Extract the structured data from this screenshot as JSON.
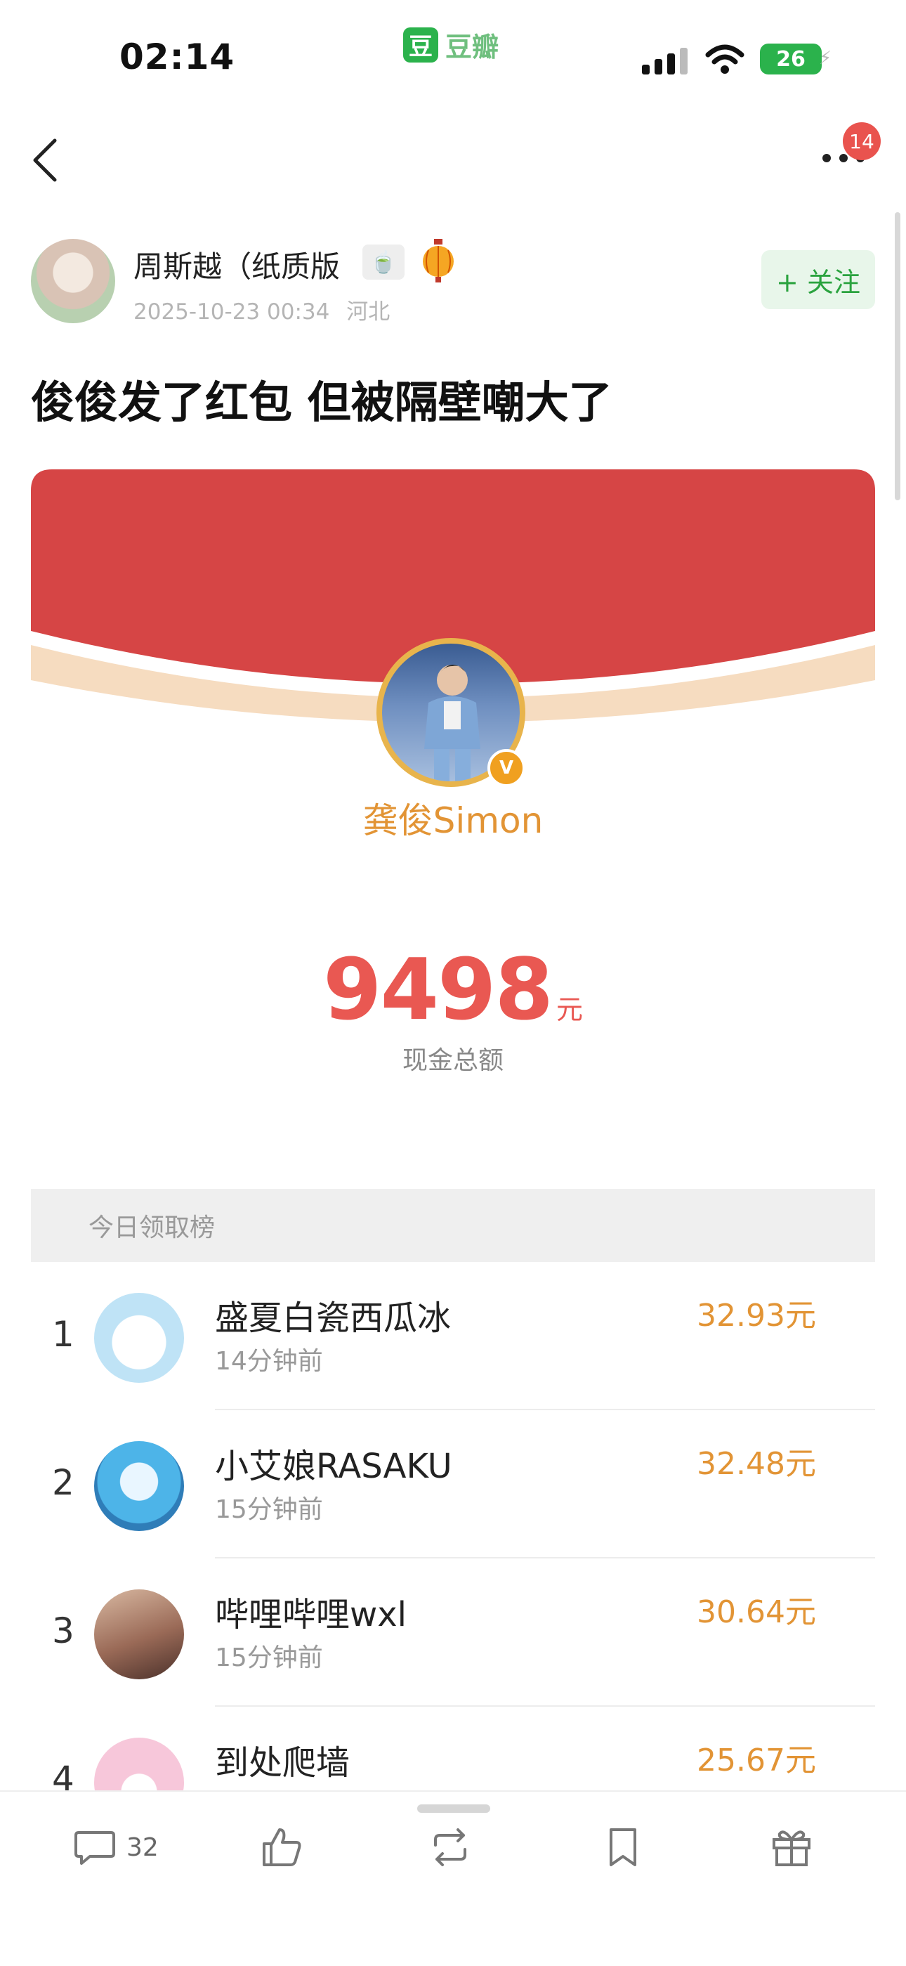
{
  "status_bar": {
    "time": "02:14",
    "app_name": "豆瓣",
    "app_logo": "豆",
    "battery": "26"
  },
  "nav": {
    "notification_count": "14"
  },
  "author": {
    "name": "周斯越（纸质版",
    "date": "2025-10-23 00:34",
    "location": "河北",
    "follow_label": "+ 关注"
  },
  "post": {
    "title": "俊俊发了红包 但被隔壁嘲大了"
  },
  "red_packet": {
    "sender": "龚俊Simon",
    "verified": "V",
    "amount": "9498",
    "unit": "元",
    "amount_label": "现金总额"
  },
  "ranking": {
    "header": "今日领取榜",
    "rows": [
      {
        "rank": "1",
        "name": "盛夏白瓷西瓜冰",
        "time": "14分钟前",
        "amount": "32.93元"
      },
      {
        "rank": "2",
        "name": "小艾娘RASAKU",
        "time": "15分钟前",
        "amount": "32.48元"
      },
      {
        "rank": "3",
        "name": "哔哩哔哩wxl",
        "time": "15分钟前",
        "amount": "30.64元"
      },
      {
        "rank": "4",
        "name": "到处爬墙",
        "time": "",
        "amount": "25.67元"
      }
    ]
  },
  "toolbar": {
    "comment_count": "32"
  },
  "colors": {
    "douban_green": "#2bb24c",
    "packet_red": "#d64545",
    "accent_orange": "#e29435",
    "amount_red": "#e95852"
  }
}
